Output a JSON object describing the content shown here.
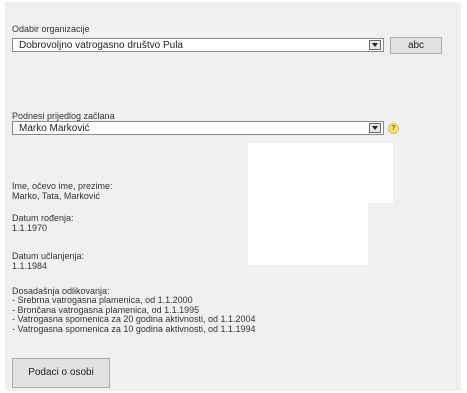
{
  "organization": {
    "label": "Odabir organizacije",
    "selected": "Dobrovoljno vatrogasno društvo Pula",
    "button": "abc"
  },
  "proposer": {
    "label": "Podnesi prijedlog začlana",
    "selected": "Marko Marković",
    "help_icon": "question-icon"
  },
  "person": {
    "name_label": "Ime, očevo ime, prezime:",
    "name_value": "Marko, Tata, Marković",
    "birth_label": "Datum rođenja:",
    "birth_value": "1.1.1970",
    "join_label": "Datum učlanjenja:",
    "join_value": "1.1.1984",
    "awards_label": "Dosadašnja odlikovanja:",
    "awards": [
      "- Srebrna vatrogasna plamenica, od 1.1.2000",
      "- Brončana vatrogasna plamenica, od 1.1.1995",
      "- Vatrogasna spomenica za 20 godina aktivnosti, od 1.1.2004",
      "- Vatrogasna spomenica za 10 godina aktivnosti, od 1.1.1994"
    ]
  },
  "details_button": "Podaci o osobi"
}
